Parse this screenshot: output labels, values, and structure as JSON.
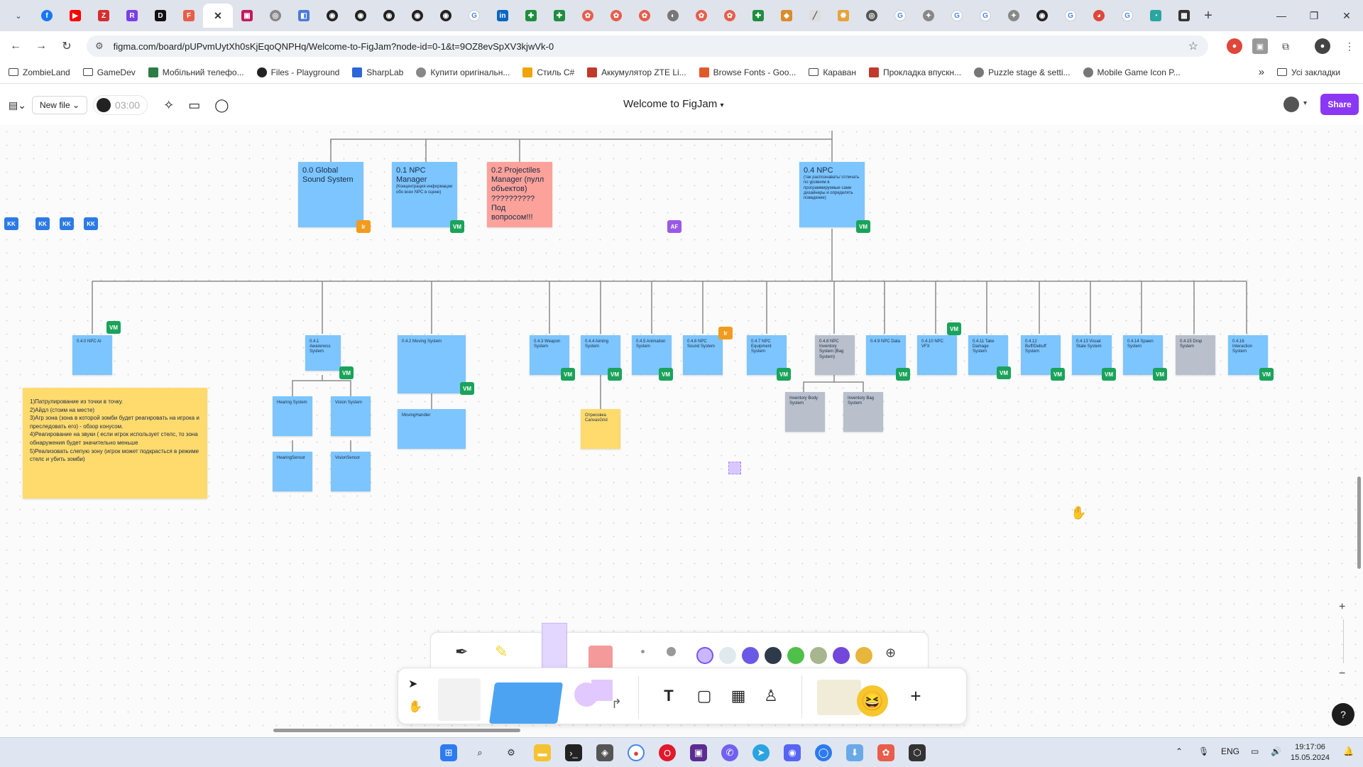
{
  "browser": {
    "url": "figma.com/board/pUPvmUytXh0sKjEqoQNPHq/Welcome-to-FigJam?node-id=0-1&t=9OZ8evSpXV3kjwVk-0",
    "tab_close_glyph": "✕",
    "new_tab_glyph": "+",
    "bookmarks": [
      {
        "label": "ZombieLand",
        "icon": "folder-icon"
      },
      {
        "label": "GameDev",
        "icon": "folder-icon"
      },
      {
        "label": "Мобільний телефо...",
        "icon": "site-icon"
      },
      {
        "label": "Files - Playground",
        "icon": "site-icon"
      },
      {
        "label": "SharpLab",
        "icon": "site-icon"
      },
      {
        "label": "Купити оригінальн...",
        "icon": "site-icon"
      },
      {
        "label": "Стиль C#",
        "icon": "site-icon"
      },
      {
        "label": "Аккумулятор ZTE Li...",
        "icon": "site-icon"
      },
      {
        "label": "Browse Fonts - Goo...",
        "icon": "site-icon"
      },
      {
        "label": "Караван",
        "icon": "folder-icon"
      },
      {
        "label": "Прокладка впускн...",
        "icon": "site-icon"
      },
      {
        "label": "Puzzle stage & setti...",
        "icon": "site-icon"
      },
      {
        "label": "Mobile Game Icon P...",
        "icon": "site-icon"
      }
    ],
    "bookmarks_more": "»",
    "all_bookmarks": "Усі закладки"
  },
  "figjam": {
    "new_file": "New file",
    "timer": "03:00",
    "title": "Welcome to FigJam",
    "share": "Share"
  },
  "board": {
    "top_notes": [
      {
        "text": "0.0 Global Sound System",
        "badge": "Ir",
        "badge_color": "orange"
      },
      {
        "text": "0.1 NPC Manager",
        "sub": "(Концентрация информации обо всех NPC в сцене)",
        "badge": "VM",
        "badge_color": "green"
      },
      {
        "text": "0.2 Projectiles Manager (пулл объектов) ?????????? Под вопросом!!!",
        "badge": "",
        "badge_color": ""
      },
      {
        "text": "0.4 NPC",
        "sub": "(так распознавать/ отличать по уровням в программируемые сами дизайнеры и определять поведение)",
        "badge": "VM",
        "badge_color": "green"
      }
    ],
    "kk_badges": [
      "KK",
      "KK",
      "KK",
      "KK"
    ],
    "af_badge": "AF",
    "mid_notes": [
      {
        "text": "0.4.0 NPC AI",
        "color": "blue",
        "badge": "VM"
      },
      {
        "text": "0.4.1 Awareness System",
        "color": "blue",
        "badge": "VM"
      },
      {
        "text": "0.4.2 Moving System",
        "color": "blue",
        "badge": "VM"
      },
      {
        "text": "0.4.3 Weapon System",
        "color": "blue",
        "badge": "VM"
      },
      {
        "text": "0.4.4 Aiming System",
        "color": "blue",
        "badge": "VM"
      },
      {
        "text": "0.4.5 Animation System",
        "color": "blue",
        "badge": "VM"
      },
      {
        "text": "0.4.6 NPC Sound System",
        "color": "blue",
        "badge": "Ir"
      },
      {
        "text": "0.4.7 NPC Equipment System",
        "color": "blue",
        "badge": "VM"
      },
      {
        "text": "0.4.8 NPC Inventory System (Bag System)",
        "color": "gray",
        "badge": ""
      },
      {
        "text": "0.4.9 NPC Data",
        "color": "blue",
        "badge": "VM"
      },
      {
        "text": "0.4.10 NPC VFX",
        "color": "blue",
        "badge": "VM"
      },
      {
        "text": "0.4.11 Take Damage System",
        "color": "blue",
        "badge": "VM"
      },
      {
        "text": "0.4.12 Buff/Debuff System",
        "color": "blue",
        "badge": "VM"
      },
      {
        "text": "0.4.13 Visual State System",
        "color": "blue",
        "badge": "VM"
      },
      {
        "text": "0.4.14 Spawn System",
        "color": "blue",
        "badge": "VM"
      },
      {
        "text": "0.4.15 Drop System",
        "color": "gray",
        "badge": ""
      },
      {
        "text": "0.4.16 Interaction System",
        "color": "blue",
        "badge": "VM"
      }
    ],
    "sub_notes": [
      {
        "text": "Hearing System"
      },
      {
        "text": "Vision System"
      },
      {
        "text": "HearingSensor"
      },
      {
        "text": "VisionSensor"
      },
      {
        "text": "MovingHandler"
      },
      {
        "text": "Отрисовка CanvasGrid"
      },
      {
        "text": "Inventory Body System"
      },
      {
        "text": "Inventory Bag System"
      }
    ],
    "yellow_note": [
      "1)Патрулирование из точки в точку.",
      "2)Айдл (стоим на месте)",
      "3)Агр зона (зона в которой зомби будет реагировать на игрока и преследовать его) - обзор конусом.",
      "4)Реагирование на звуки ( если игрок использует стелс, то зона обнаружения будет значительно меньше",
      "5)Реализовать слепую зону (игрок может подкрасться в режиме стелс и убить зомби)"
    ]
  },
  "zoom": {
    "plus": "+",
    "minus": "−",
    "help": "?"
  },
  "taskbar": {
    "lang": "ENG",
    "time": "19:17:06",
    "date": "15.05.2024"
  },
  "colors": {
    "share": "#8a38f5",
    "sticky_blue": "#7cc5ff",
    "sticky_gray": "#b9c0cc",
    "sticky_pink": "#fca29a",
    "sticky_yellow": "#ffdb6e",
    "badge_green": "#1aa35a"
  }
}
